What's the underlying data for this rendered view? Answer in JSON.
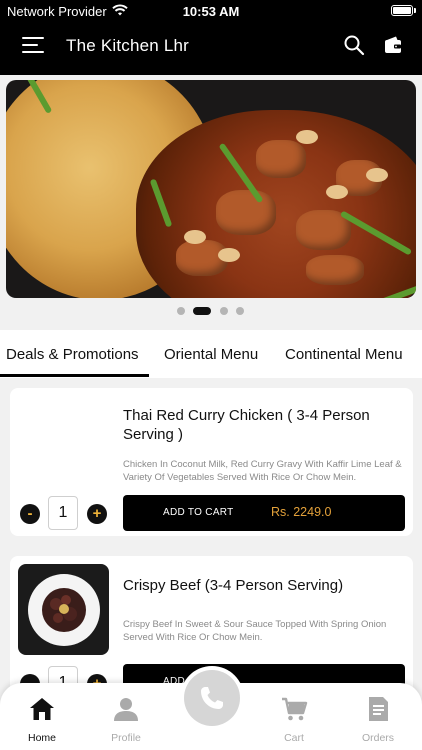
{
  "status_bar": {
    "carrier": "Network Provider",
    "time": "10:53 AM"
  },
  "header": {
    "title": "The Kitchen Lhr"
  },
  "banner": {
    "slides": 4,
    "active_slide": 2
  },
  "tabs": [
    {
      "label": "Deals & Promotions",
      "active": true
    },
    {
      "label": "Oriental Menu",
      "active": false
    },
    {
      "label": "Continental Menu",
      "active": false
    }
  ],
  "items": [
    {
      "title": "Thai Red Curry Chicken ( 3-4 Person Serving )",
      "description": "Chicken In Coconut Milk, Red Curry Gravy With Kaffir Lime Leaf & Variety Of Vegetables Served With Rice Or Chow Mein.",
      "quantity": "1",
      "minus": "-",
      "plus": "+",
      "add_label": "ADD TO CART",
      "price": "Rs. 2249.0"
    },
    {
      "title": "Crispy Beef (3-4 Person Serving)",
      "description": "Crispy Beef In Sweet & Sour Sauce Topped With Spring Onion Served With Rice Or Chow Mein.",
      "quantity": "1",
      "minus": "-",
      "plus": "+",
      "add_label": "ADD TO CART",
      "price": ""
    }
  ],
  "bottom_nav": [
    {
      "label": "Home",
      "icon": "home-icon",
      "active": true
    },
    {
      "label": "Profile",
      "icon": "user-icon",
      "active": false
    },
    {
      "label": "Cart",
      "icon": "cart-icon",
      "active": false
    },
    {
      "label": "Orders",
      "icon": "orders-icon",
      "active": false
    }
  ],
  "colors": {
    "accent": "#e3a13a",
    "header": "#000000",
    "inactive": "#aaaaaa"
  }
}
